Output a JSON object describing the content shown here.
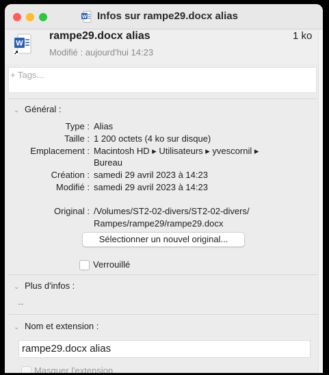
{
  "window": {
    "title": "Infos sur rampe29.docx alias"
  },
  "header": {
    "file_name": "rampe29.docx alias",
    "file_size": "1 ko",
    "modified": "Modifié : aujourd'hui 14:23"
  },
  "tags": {
    "placeholder": "+ Tags..."
  },
  "general": {
    "heading": "Général :",
    "rows": [
      {
        "label": "Type :",
        "value": "Alias"
      },
      {
        "label": "Taille :",
        "value": "1 200 octets (4 ko sur disque)"
      },
      {
        "label": "Emplacement :",
        "value": "Macintosh HD ▸ Utilisateurs ▸ yvescornil ▸",
        "value2": "Bureau"
      },
      {
        "label": "Création :",
        "value": "samedi 29 avril 2023 à 14:23"
      },
      {
        "label": "Modifié :",
        "value": "samedi 29 avril 2023 à 14:23"
      },
      {
        "label": "Original :",
        "value": "/Volumes/ST2-02-divers/ST2-02-divers/",
        "value2": "Rampes/rampe29/rampe29.docx"
      }
    ],
    "select_button": "Sélectionner un nouvel original...",
    "locked_label": "Verrouillé"
  },
  "more_info": {
    "heading": "Plus d'infos :",
    "value": "--"
  },
  "name_ext": {
    "heading": "Nom et extension :",
    "name_value": "rampe29.docx alias",
    "hide_ext_label": "Masquer l'extension"
  },
  "colors": {
    "close": "#ff5f57",
    "minimize": "#febc2e",
    "zoom": "#28c840",
    "word_blue": "#2b5fb4"
  },
  "icons": [
    "close-button",
    "minimize-button",
    "zoom-button",
    "word-document-icon",
    "alias-arrow-icon",
    "chevron-down-icon"
  ]
}
